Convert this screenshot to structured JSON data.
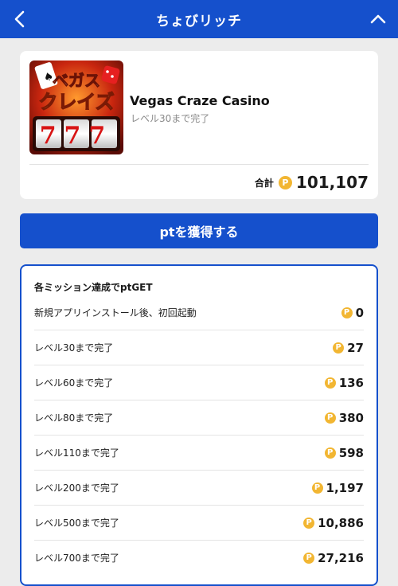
{
  "header": {
    "title": "ちょびリッチ",
    "back_icon": "chevron-left-icon",
    "collapse_icon": "chevron-up-icon"
  },
  "app": {
    "icon_text_top": "ベガス",
    "icon_text_mid": "クレイズ",
    "icon_digits": "777",
    "name": "Vegas Craze Casino",
    "subtitle": "レベル30まで完了",
    "total_label": "合計",
    "coin_symbol": "P",
    "total_value": "101,107"
  },
  "cta": {
    "label": "ptを獲得する"
  },
  "missions": {
    "heading": "各ミッション達成でptGET",
    "items": [
      {
        "label": "新規アプリインストール後、初回起動",
        "points": "0"
      },
      {
        "label": "レベル30まで完了",
        "points": "27"
      },
      {
        "label": "レベル60まで完了",
        "points": "136"
      },
      {
        "label": "レベル80まで完了",
        "points": "380"
      },
      {
        "label": "レベル110まで完了",
        "points": "598"
      },
      {
        "label": "レベル200まで完了",
        "points": "1,197"
      },
      {
        "label": "レベル500まで完了",
        "points": "10,886"
      },
      {
        "label": "レベル700まで完了",
        "points": "27,216"
      }
    ]
  },
  "colors": {
    "brand_blue": "#1550cc",
    "coin_gold": "#f2b632",
    "background": "#ececec"
  }
}
